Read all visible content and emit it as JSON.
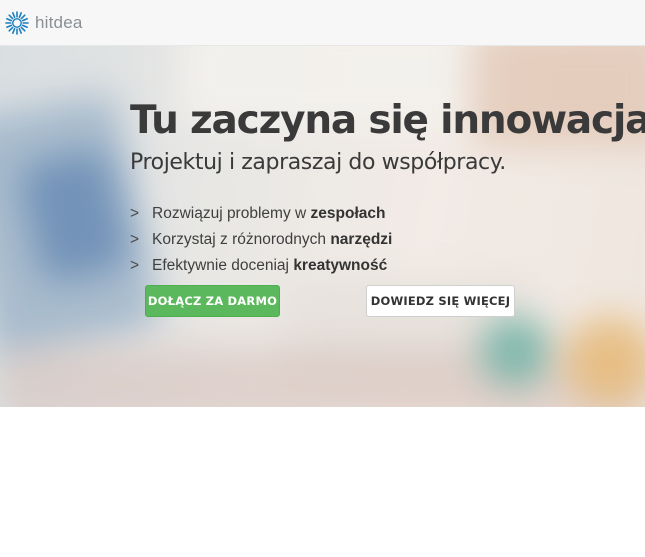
{
  "navbar": {
    "brand_name": "hitdea",
    "logo_icon": "sunburst-logo-icon",
    "brand_color": "#1a7fc1"
  },
  "hero": {
    "title": "Tu zaczyna się innowacja!",
    "subtitle": "Projektuj i zapraszaj do współpracy.",
    "features": [
      {
        "icon": "chevron-right-icon",
        "text": "Rozwiązuj problemy w ",
        "bold": "zespołach"
      },
      {
        "icon": "chevron-right-icon",
        "text": "Korzystaj z różnorodnych ",
        "bold": "narzędzi"
      },
      {
        "icon": "chevron-right-icon",
        "text": "Efektywnie doceniaj ",
        "bold": "kreatywność"
      }
    ],
    "join_button": "DOŁĄCZ ZA DARMO",
    "more_button": "DOWIEDZ SIĘ WIĘCEJ"
  },
  "colors": {
    "join_button": "#5cb85c",
    "text_dark": "#3a3a3a",
    "navbar_bg": "#f7f7f7"
  }
}
